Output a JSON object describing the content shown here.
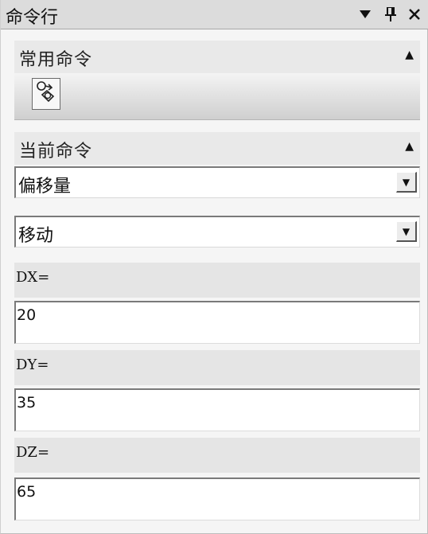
{
  "window": {
    "title": "命令行"
  },
  "titlebar_icons": [
    "dropdown-icon",
    "pin-icon",
    "close-icon"
  ],
  "common_commands": {
    "label": "常用命令",
    "tools": [
      {
        "icon": "move-object-icon"
      }
    ]
  },
  "current_command": {
    "label": "当前命令",
    "mode_select": {
      "value": "偏移量"
    },
    "command_select": {
      "value": "移动"
    },
    "fields": [
      {
        "label": "DX=",
        "value": "20"
      },
      {
        "label": "DY=",
        "value": "35"
      },
      {
        "label": "DZ=",
        "value": "65"
      }
    ]
  }
}
